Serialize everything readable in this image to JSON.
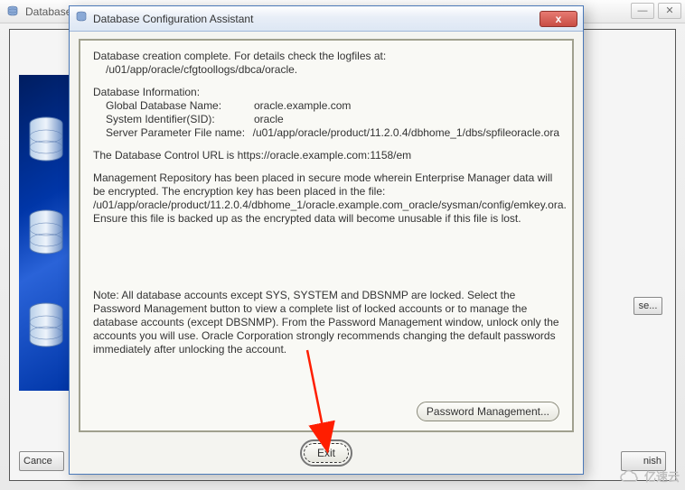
{
  "bg": {
    "title_prefix": "Database ",
    "right_btn": "se...",
    "cancel": "Cance",
    "finish": "nish"
  },
  "dlg": {
    "title": "Database Configuration Assistant",
    "close": "x",
    "para1_line1": "Database creation complete. For details check the logfiles at:",
    "para1_line2": "/u01/app/oracle/cfgtoollogs/dbca/oracle.",
    "info_heading": "Database Information:",
    "info": {
      "gdn_label": "Global Database Name:",
      "gdn_value": "oracle.example.com",
      "sid_label": "System Identifier(SID):",
      "sid_value": "oracle",
      "spf_label": "Server Parameter File name:",
      "spf_value": "/u01/app/oracle/product/11.2.0.4/dbhome_1/dbs/spfileoracle.ora"
    },
    "para_url": "The Database Control URL is https://oracle.example.com:1158/em",
    "para_mgmt": "Management Repository has been placed in secure mode wherein Enterprise Manager data will be encrypted.  The encryption key has been placed in the file: /u01/app/oracle/product/11.2.0.4/dbhome_1/oracle.example.com_oracle/sysman/config/emkey.ora. Ensure this file is backed up as the encrypted data will become unusable if this file is lost.",
    "para_note": "Note: All database accounts except SYS, SYSTEM and DBSNMP are locked. Select the Password Management button to view a complete list of locked accounts or to manage the database accounts (except DBSNMP). From the Password Management window, unlock only the accounts you will use. Oracle Corporation strongly recommends changing the default passwords immediately after unlocking the account.",
    "pwd_mgmt": "Password Management...",
    "exit": "Exit"
  },
  "watermark": "亿速云",
  "chart_data": {
    "type": "none"
  }
}
